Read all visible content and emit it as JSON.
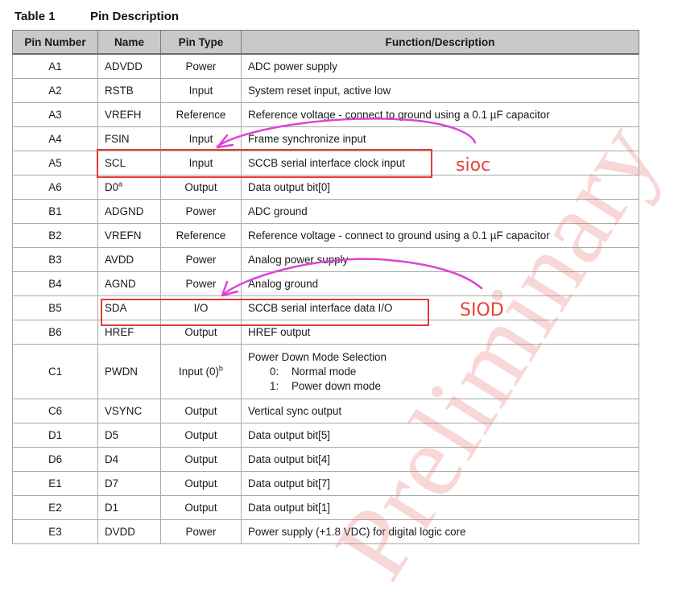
{
  "caption": {
    "table_number": "Table 1",
    "title": "Pin Description"
  },
  "columns": [
    "Pin Number",
    "Name",
    "Pin Type",
    "Function/Description"
  ],
  "rows": [
    {
      "pin": "A1",
      "name": "ADVDD",
      "type": "Power",
      "desc": "ADC power supply"
    },
    {
      "pin": "A2",
      "name": "RSTB",
      "type": "Input",
      "desc": "System reset input, active low"
    },
    {
      "pin": "A3",
      "name": "VREFH",
      "type": "Reference",
      "desc": "Reference voltage - connect to ground using a 0.1 µF capacitor"
    },
    {
      "pin": "A4",
      "name": "FSIN",
      "type": "Input",
      "desc": "Frame synchronize input"
    },
    {
      "pin": "A5",
      "name": "SCL",
      "type": "Input",
      "desc": "SCCB serial interface clock input"
    },
    {
      "pin": "A6",
      "name": "D0",
      "name_sup": "a",
      "type": "Output",
      "desc": "Data output bit[0]"
    },
    {
      "pin": "B1",
      "name": "ADGND",
      "type": "Power",
      "desc": "ADC ground"
    },
    {
      "pin": "B2",
      "name": "VREFN",
      "type": "Reference",
      "desc": "Reference voltage - connect to ground using a 0.1 µF capacitor"
    },
    {
      "pin": "B3",
      "name": "AVDD",
      "type": "Power",
      "desc": "Analog power supply"
    },
    {
      "pin": "B4",
      "name": "AGND",
      "type": "Power",
      "desc": "Analog ground"
    },
    {
      "pin": "B5",
      "name": "SDA",
      "type": "I/O",
      "desc": "SCCB serial interface data I/O"
    },
    {
      "pin": "B6",
      "name": "HREF",
      "type": "Output",
      "desc": "HREF output"
    },
    {
      "pin": "C1",
      "name": "PWDN",
      "type": "Input (0)",
      "type_sup": "b",
      "desc": "Power Down Mode Selection",
      "options": [
        {
          "key": "0:",
          "text": "Normal mode"
        },
        {
          "key": "1:",
          "text": "Power down mode"
        }
      ]
    },
    {
      "pin": "C6",
      "name": "VSYNC",
      "type": "Output",
      "desc": "Vertical sync output"
    },
    {
      "pin": "D1",
      "name": "D5",
      "type": "Output",
      "desc": "Data output bit[5]"
    },
    {
      "pin": "D6",
      "name": "D4",
      "type": "Output",
      "desc": "Data output bit[4]"
    },
    {
      "pin": "E1",
      "name": "D7",
      "type": "Output",
      "desc": "Data output bit[7]"
    },
    {
      "pin": "E2",
      "name": "D1",
      "type": "Output",
      "desc": "Data output bit[1]"
    },
    {
      "pin": "E3",
      "name": "DVDD",
      "type": "Power",
      "desc": "Power supply (+1.8 VDC) for digital logic core"
    }
  ],
  "annotations": {
    "sioc_label": "sioc",
    "siod_label": "SIOD",
    "watermark": "Preliminary",
    "box_color": "#e53b34",
    "arrow_color": "#e040d8",
    "watermark_color": "#e66e6e"
  }
}
